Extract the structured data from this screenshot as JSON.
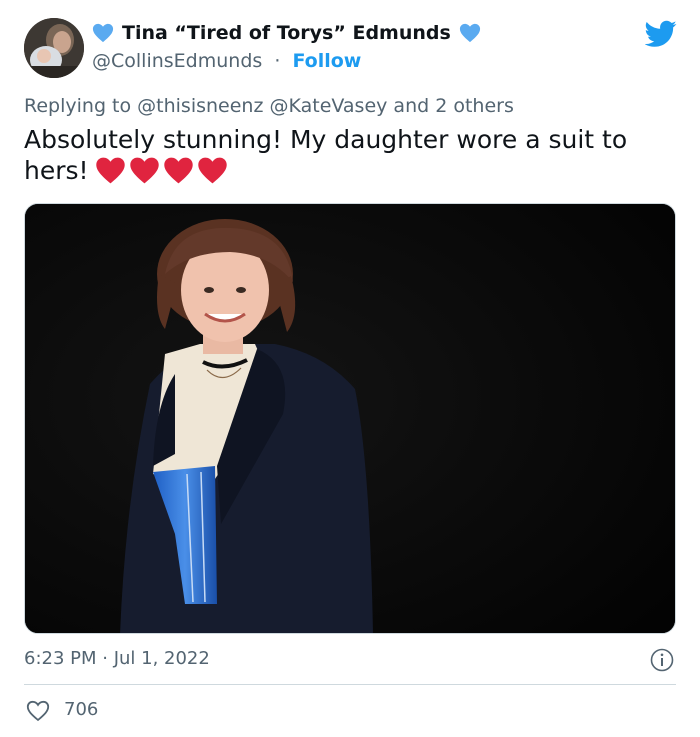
{
  "author": {
    "display_name": "Tina “Tired of Torys” Edmunds",
    "handle": "@CollinsEdmunds",
    "separator": "·",
    "follow_label": "Follow",
    "badge_icon": "blue-heart-icon",
    "badge_color": "#5aaaf0"
  },
  "platform_icon": "twitter-bird-icon",
  "reply_context": "Replying to @thisisneenz @KateVasey and 2 others",
  "tweet": {
    "text": "Absolutely stunning! My daughter wore a suit to hers!",
    "emoji_icons": [
      "red-heart-icon",
      "red-heart-icon",
      "red-heart-icon",
      "red-heart-icon"
    ]
  },
  "timestamp": "6:23 PM · Jul 1, 2022",
  "likes": "706",
  "colors": {
    "accent": "#1d9bf0",
    "muted_text": "#536471",
    "heart_red": "#e0243f",
    "text": "#0f1419"
  }
}
